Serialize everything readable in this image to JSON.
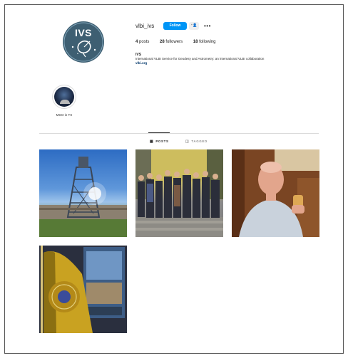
{
  "profile": {
    "username": "vlbi_ivs",
    "follow_label": "Follow",
    "suggest_icon": "person-add-icon",
    "more_icon": "more-dots-icon",
    "avatar_text": "IVS"
  },
  "stats": {
    "posts_count": "4",
    "posts_label": "posts",
    "followers_count": "28",
    "followers_label": "followers",
    "following_count": "18",
    "following_label": "following"
  },
  "bio": {
    "name": "IVS",
    "description": "International VLBI Service for Geodesy and Astrometry: an international VLBI collaboration",
    "link": "vlbi.org"
  },
  "highlights": [
    {
      "label": "MGO in TX"
    }
  ],
  "tabs": {
    "posts_label": "POSTS",
    "tagged_label": "TAGGED"
  },
  "colors": {
    "accent": "#0095f6",
    "avatar_bg": "#3e5f72",
    "link": "#00376b"
  }
}
